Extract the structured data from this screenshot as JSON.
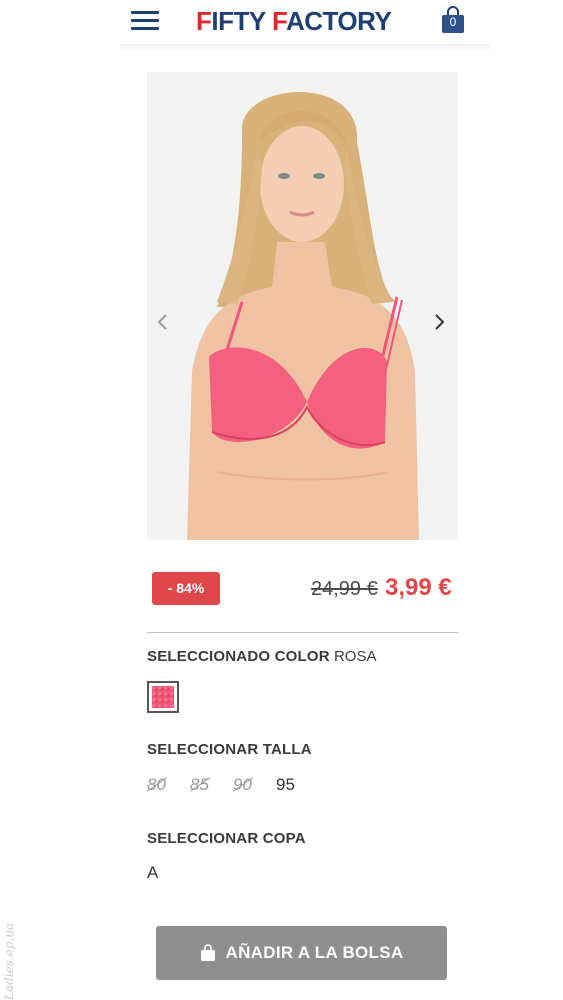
{
  "header": {
    "brand_part1": "F",
    "brand_part2": "IFTY ",
    "brand_part3": "F",
    "brand_part4": "ACTORY",
    "cart_count": "0",
    "brand_color": "#1f3f73",
    "accent_color": "#e0252b"
  },
  "product": {
    "image_desc_icon": "model-photo",
    "discount": "- 84%",
    "old_price": "24,99 €",
    "new_price": "3,99 €",
    "price_color": "#e0474a"
  },
  "color": {
    "heading_bold": "SELECCIONADO COLOR",
    "selected": "ROSA",
    "swatch_color": "#f05878"
  },
  "size": {
    "heading": "SELECCIONAR TALLA",
    "options": [
      "80",
      "85",
      "90",
      "95"
    ],
    "available": [
      "95"
    ]
  },
  "cup": {
    "heading": "SELECCIONAR COPA",
    "options": [
      "A"
    ]
  },
  "cta": {
    "label": "AÑADIR A LA BOLSA"
  },
  "watermark": "Ladies.ep.ua"
}
